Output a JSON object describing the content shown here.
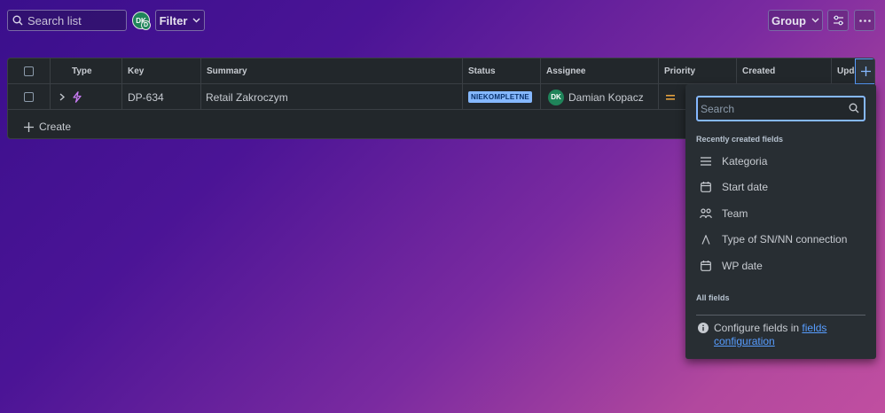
{
  "toolbar": {
    "search_placeholder": "Search list",
    "avatar_initials": "DK",
    "avatar_badge": "D",
    "filter_label": "Filter",
    "group_label": "Group"
  },
  "table": {
    "columns": [
      "Type",
      "Key",
      "Summary",
      "Status",
      "Assignee",
      "Priority",
      "Created",
      "Upda"
    ],
    "rows": [
      {
        "key": "DP-634",
        "summary": "Retail Zakroczym",
        "status": "NIEKOMPLETNE",
        "assignee_initials": "DK",
        "assignee": "Damian Kopacz"
      }
    ],
    "create_label": "Create"
  },
  "dropdown": {
    "search_placeholder": "Search",
    "recent_header": "Recently created fields",
    "recent_items": [
      {
        "label": "Kategoria",
        "icon": "list-icon"
      },
      {
        "label": "Start date",
        "icon": "calendar-icon"
      },
      {
        "label": "Team",
        "icon": "people-icon"
      },
      {
        "label": "Type of SN/NN connection",
        "icon": "text-icon"
      },
      {
        "label": "WP date",
        "icon": "calendar-icon"
      }
    ],
    "all_header": "All fields",
    "info_text": "Configure fields in",
    "info_link_1": "fields",
    "info_link_2": "configuration"
  },
  "colors": {
    "accent": "#579dff",
    "status_badge": "#85b8ff",
    "avatar": "#1f845a",
    "priority": "#e2a03f"
  }
}
